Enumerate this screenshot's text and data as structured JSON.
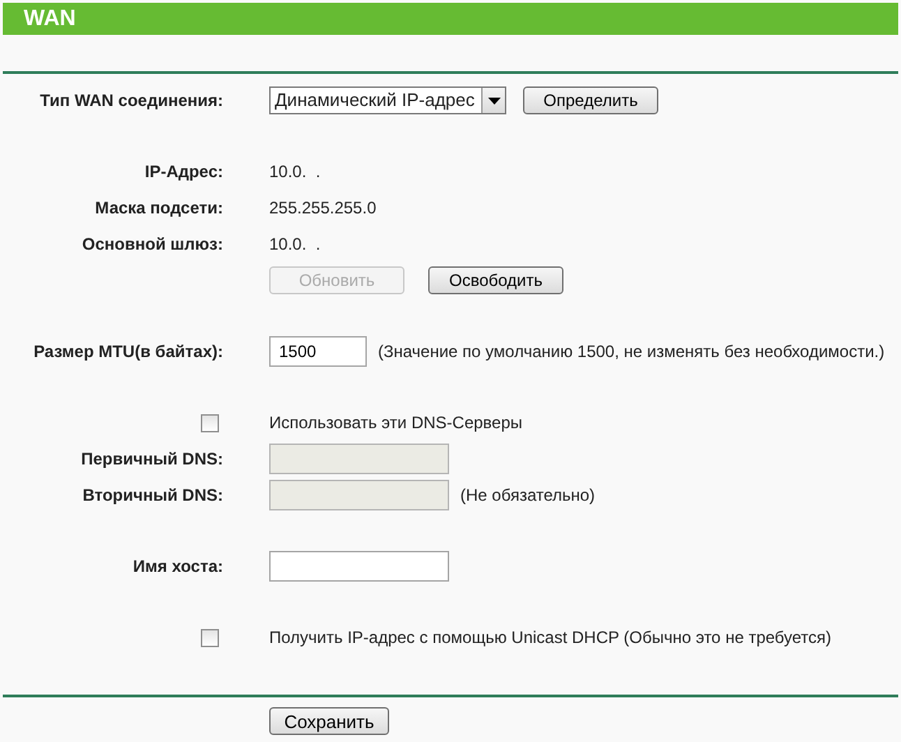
{
  "header": {
    "title": "WAN"
  },
  "sections": [
    {
      "rows": [
        {
          "kind": "select",
          "label": "Тип WAN соединения:",
          "value": "Динамический IP-адрес",
          "button": {
            "label": "Определить",
            "disabled": false
          }
        }
      ]
    },
    {
      "rows": [
        {
          "kind": "info",
          "label": "IP-Адрес:",
          "value": "10.0.  ."
        },
        {
          "kind": "info",
          "label": "Маска подсети:",
          "value": "255.255.255.0"
        },
        {
          "kind": "info",
          "label": "Основной шлюз:",
          "value": "10.0.  ."
        },
        {
          "kind": "buttons",
          "buttons": [
            {
              "label": "Обновить",
              "disabled": true
            },
            {
              "label": "Освободить",
              "disabled": false
            }
          ]
        }
      ]
    },
    {
      "rows": [
        {
          "kind": "number",
          "label": "Размер MTU(в байтах):",
          "value": "1500",
          "disabled": false,
          "note": "(Значение по умолчанию 1500, не изменять без необходимости.)"
        }
      ]
    },
    {
      "rows": [
        {
          "kind": "checkbox",
          "label": "Использовать эти DNS-Серверы",
          "checked": false
        },
        {
          "kind": "input",
          "label": "Первичный DNS:",
          "disabled": true
        },
        {
          "kind": "input",
          "label": "Вторичный DNS:",
          "disabled": true,
          "note": "(Не обязательно)"
        }
      ]
    },
    {
      "rows": [
        {
          "kind": "input",
          "label": "Имя хоста:",
          "disabled": false
        }
      ]
    },
    {
      "rows": [
        {
          "kind": "checkbox",
          "label": "Получить IP-адрес с помощью Unicast DHCP (Обычно это не требуется)",
          "checked": false
        }
      ]
    }
  ],
  "save_button": {
    "label": "Сохранить"
  }
}
